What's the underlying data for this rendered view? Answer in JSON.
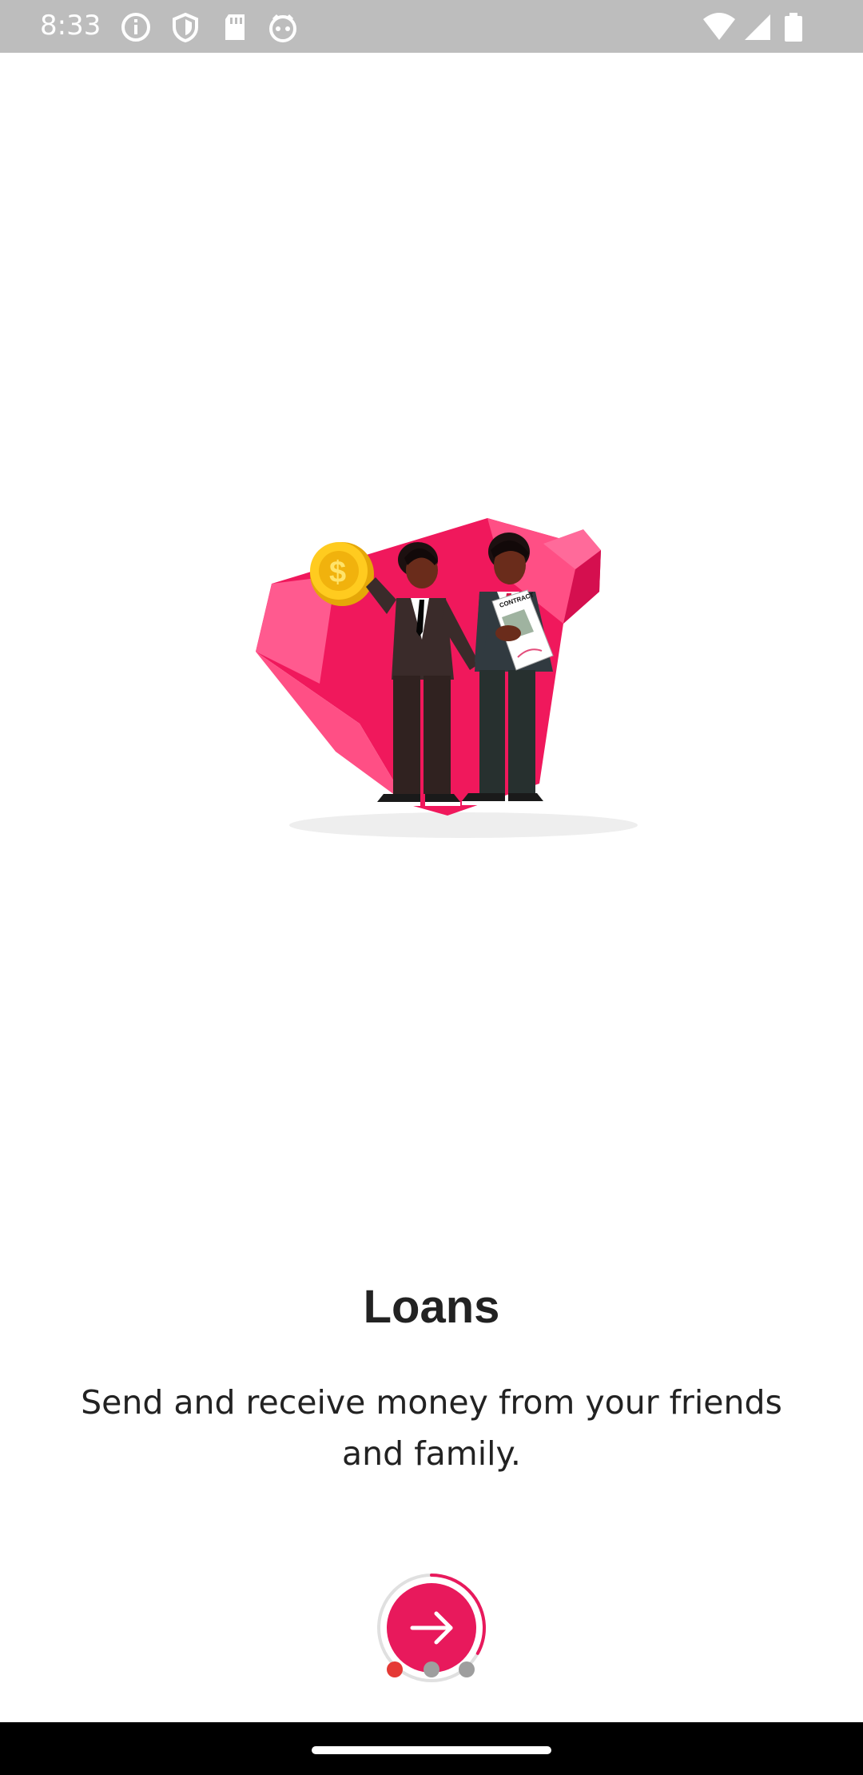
{
  "status_bar": {
    "time": "8:33",
    "left_icons": [
      "info-icon",
      "shield-icon",
      "sd-card-icon",
      "android-icon"
    ],
    "right_icons": [
      "wifi-icon",
      "signal-icon",
      "battery-icon"
    ]
  },
  "onboarding": {
    "illustration": "two-businessmen-coin-contract-illustration",
    "illustration_text": "CONTRACT",
    "title": "Loans",
    "description": "Send and receive money from your friends and family.",
    "next_button_icon": "arrow-right-icon",
    "page_indicator": {
      "total": 3,
      "current": 1,
      "progress": 0.33
    }
  },
  "colors": {
    "accent": "#e8195c",
    "active_dot": "#e53935",
    "inactive_dot": "#9e9e9e",
    "status_bar": "#bdbdbd",
    "nav_bar": "#000000"
  }
}
